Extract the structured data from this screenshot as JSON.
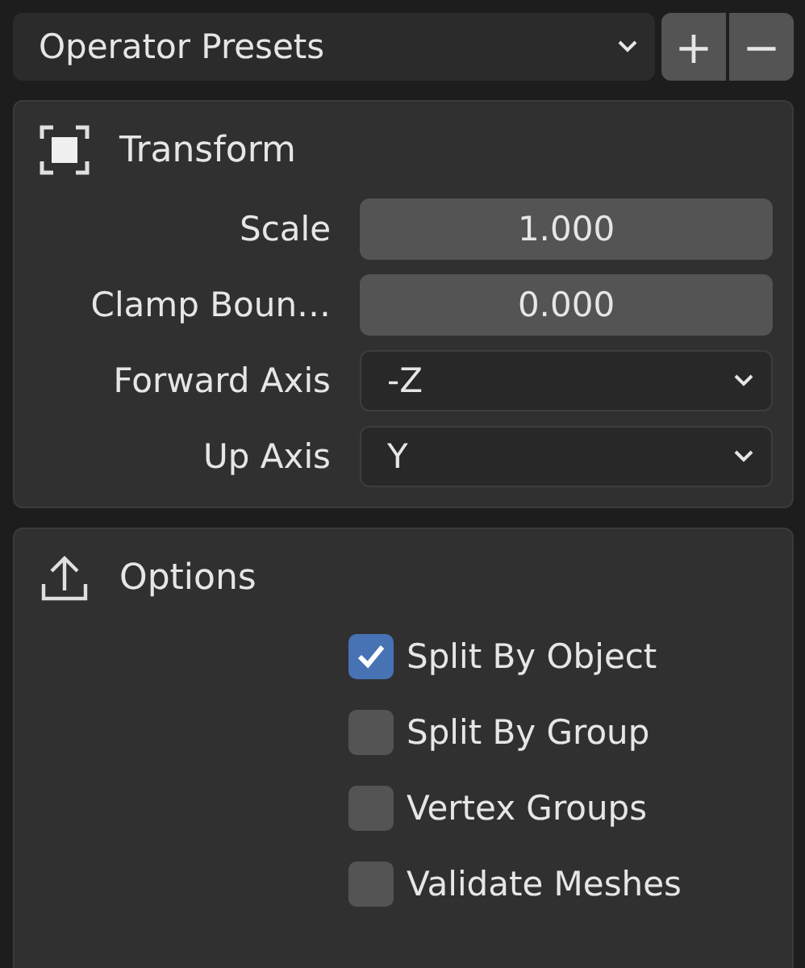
{
  "presets": {
    "label": "Operator Presets",
    "buttons": [
      "+",
      "−"
    ]
  },
  "panels": [
    {
      "title": "Transform",
      "rows": [
        {
          "kind": "number",
          "label": "Scale",
          "value": "1.000"
        },
        {
          "kind": "number",
          "label": "Clamp Boun…",
          "value": "0.000"
        },
        {
          "kind": "dropdown",
          "label": "Forward Axis",
          "value": "-Z"
        },
        {
          "kind": "dropdown",
          "label": "Up Axis",
          "value": "Y"
        }
      ]
    },
    {
      "title": "Options",
      "rows": [
        {
          "kind": "checkbox",
          "label": "Split By Object",
          "checked": true
        },
        {
          "kind": "checkbox",
          "label": "Split By Group",
          "checked": false
        },
        {
          "kind": "checkbox",
          "label": "Vertex Groups",
          "checked": false
        },
        {
          "kind": "checkbox",
          "label": "Validate Meshes",
          "checked": false
        }
      ]
    }
  ]
}
